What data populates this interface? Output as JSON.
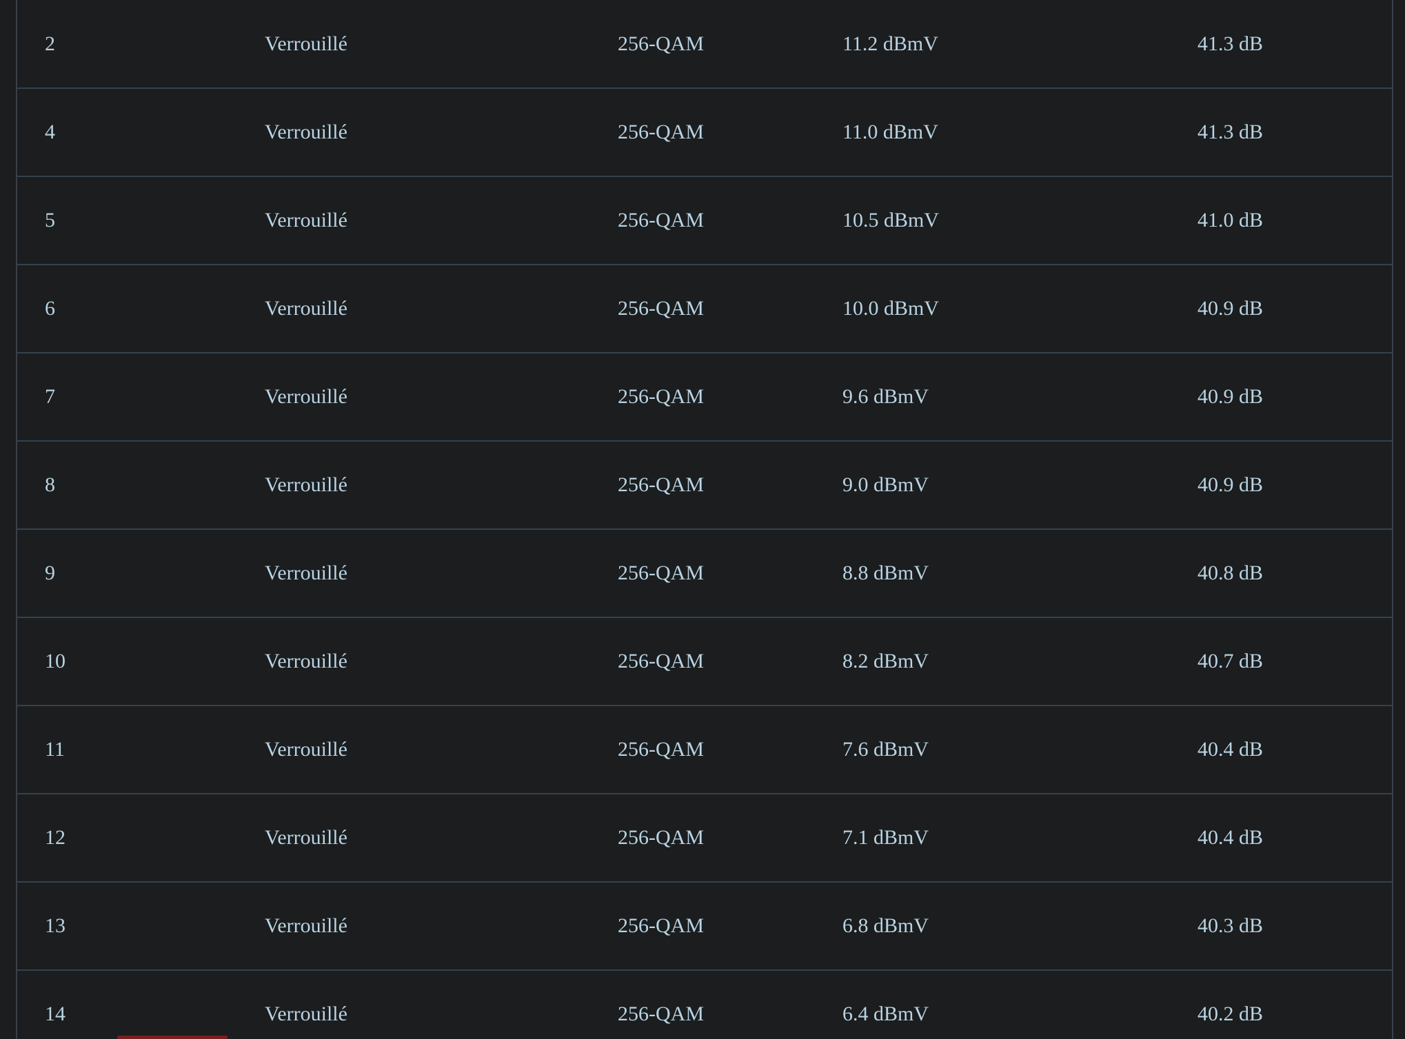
{
  "table": {
    "rows": [
      {
        "channel": "2",
        "status": "Verrouillé",
        "modulation": "256-QAM",
        "power": "11.2 dBmV",
        "snr": "41.3 dB"
      },
      {
        "channel": "4",
        "status": "Verrouillé",
        "modulation": "256-QAM",
        "power": "11.0 dBmV",
        "snr": "41.3 dB"
      },
      {
        "channel": "5",
        "status": "Verrouillé",
        "modulation": "256-QAM",
        "power": "10.5 dBmV",
        "snr": "41.0 dB"
      },
      {
        "channel": "6",
        "status": "Verrouillé",
        "modulation": "256-QAM",
        "power": "10.0 dBmV",
        "snr": "40.9 dB"
      },
      {
        "channel": "7",
        "status": "Verrouillé",
        "modulation": "256-QAM",
        "power": "9.6 dBmV",
        "snr": "40.9 dB"
      },
      {
        "channel": "8",
        "status": "Verrouillé",
        "modulation": "256-QAM",
        "power": "9.0 dBmV",
        "snr": "40.9 dB"
      },
      {
        "channel": "9",
        "status": "Verrouillé",
        "modulation": "256-QAM",
        "power": "8.8 dBmV",
        "snr": "40.8 dB"
      },
      {
        "channel": "10",
        "status": "Verrouillé",
        "modulation": "256-QAM",
        "power": "8.2 dBmV",
        "snr": "40.7 dB"
      },
      {
        "channel": "11",
        "status": "Verrouillé",
        "modulation": "256-QAM",
        "power": "7.6 dBmV",
        "snr": "40.4 dB"
      },
      {
        "channel": "12",
        "status": "Verrouillé",
        "modulation": "256-QAM",
        "power": "7.1 dBmV",
        "snr": "40.4 dB"
      },
      {
        "channel": "13",
        "status": "Verrouillé",
        "modulation": "256-QAM",
        "power": "6.8 dBmV",
        "snr": "40.3 dB"
      },
      {
        "channel": "14",
        "status": "Verrouillé",
        "modulation": "256-QAM",
        "power": "6.4 dBmV",
        "snr": "40.2 dB"
      }
    ]
  },
  "colors": {
    "background": "#1b1d1f",
    "text": "#b9d3e2",
    "row_divider": "#33434d",
    "frame_border": "#3a4148",
    "accent": "#7a1d22"
  }
}
